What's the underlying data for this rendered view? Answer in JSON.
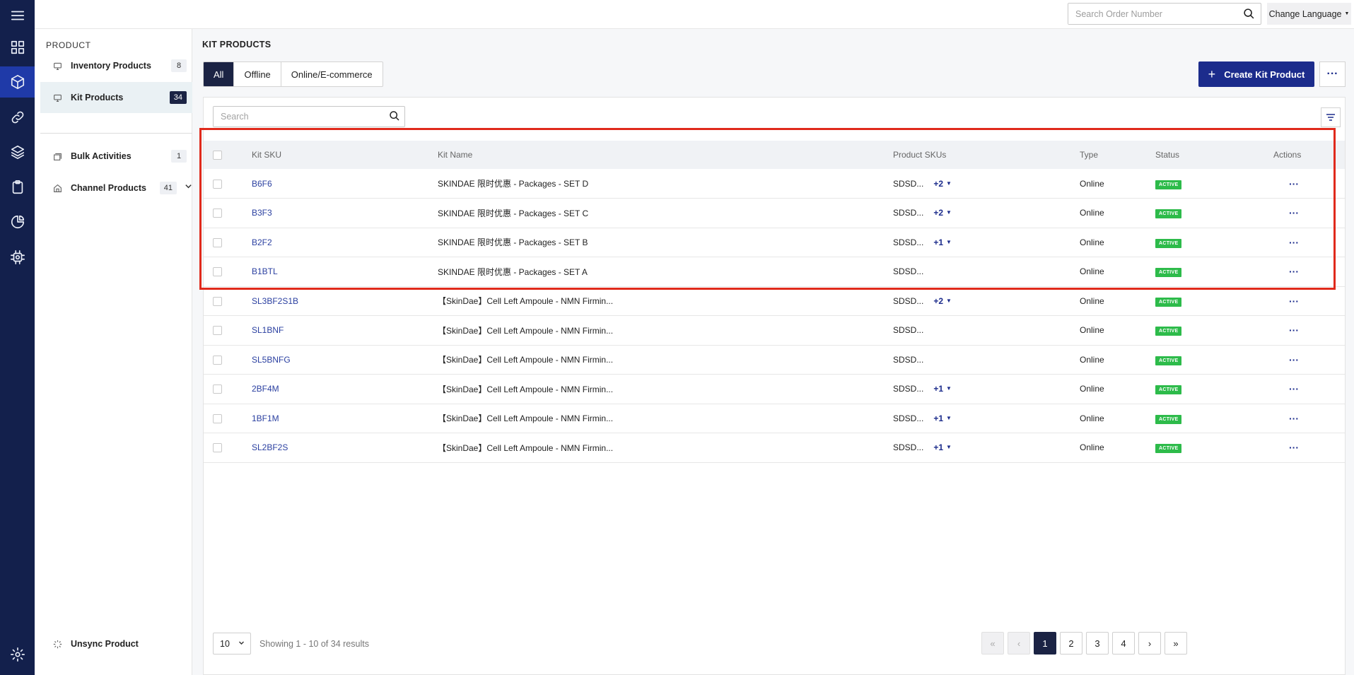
{
  "topbar": {
    "search_placeholder": "Search Order Number",
    "language_label": "Change Language"
  },
  "sidebar": {
    "header": "PRODUCT",
    "items": [
      {
        "label": "Inventory Products",
        "count": "8"
      },
      {
        "label": "Kit Products",
        "count": "34"
      },
      {
        "label": "Bulk Activities",
        "count": "1"
      },
      {
        "label": "Channel Products",
        "count": "41"
      }
    ],
    "footer_label": "Unsync Product"
  },
  "main": {
    "title": "KIT PRODUCTS",
    "tabs": [
      "All",
      "Offline",
      "Online/E-commerce"
    ],
    "create_label": "Create Kit Product",
    "search_placeholder": "Search",
    "columns": [
      "Kit SKU",
      "Kit Name",
      "Product SKUs",
      "Type",
      "Status",
      "Actions"
    ],
    "rows": [
      {
        "sku": "B6F6",
        "name": "SKINDAE 限时优惠 - Packages - SET D",
        "product_skus": "SDSD...",
        "extra": "+2",
        "type": "Online",
        "status": "ACTIVE"
      },
      {
        "sku": "B3F3",
        "name": "SKINDAE 限时优惠 - Packages - SET C",
        "product_skus": "SDSD...",
        "extra": "+2",
        "type": "Online",
        "status": "ACTIVE"
      },
      {
        "sku": "B2F2",
        "name": "SKINDAE 限时优惠 - Packages - SET B",
        "product_skus": "SDSD...",
        "extra": "+1",
        "type": "Online",
        "status": "ACTIVE"
      },
      {
        "sku": "B1BTL",
        "name": "SKINDAE 限时优惠 - Packages - SET A",
        "product_skus": "SDSD...",
        "extra": "",
        "type": "Online",
        "status": "ACTIVE"
      },
      {
        "sku": "SL3BF2S1B",
        "name": "【SkinDae】Cell Left Ampoule - NMN Firmin...",
        "product_skus": "SDSD...",
        "extra": "+2",
        "type": "Online",
        "status": "ACTIVE"
      },
      {
        "sku": "SL1BNF",
        "name": "【SkinDae】Cell Left Ampoule - NMN Firmin...",
        "product_skus": "SDSD...",
        "extra": "",
        "type": "Online",
        "status": "ACTIVE"
      },
      {
        "sku": "SL5BNFG",
        "name": "【SkinDae】Cell Left Ampoule - NMN Firmin...",
        "product_skus": "SDSD...",
        "extra": "",
        "type": "Online",
        "status": "ACTIVE"
      },
      {
        "sku": "2BF4M",
        "name": "【SkinDae】Cell Left Ampoule - NMN Firmin...",
        "product_skus": "SDSD...",
        "extra": "+1",
        "type": "Online",
        "status": "ACTIVE"
      },
      {
        "sku": "1BF1M",
        "name": "【SkinDae】Cell Left Ampoule - NMN Firmin...",
        "product_skus": "SDSD...",
        "extra": "+1",
        "type": "Online",
        "status": "ACTIVE"
      },
      {
        "sku": "SL2BF2S",
        "name": "【SkinDae】Cell Left Ampoule - NMN Firmin...",
        "product_skus": "SDSD...",
        "extra": "+1",
        "type": "Online",
        "status": "ACTIVE"
      }
    ],
    "page_size": "10",
    "showing": "Showing 1 - 10 of 34 results",
    "pages": [
      "«",
      "‹",
      "1",
      "2",
      "3",
      "4",
      "›",
      "»"
    ]
  },
  "colors": {
    "rail": "#13204c",
    "primary": "#1c2c8c",
    "active_badge": "#2dbb4a",
    "highlight": "#e02a1c"
  }
}
